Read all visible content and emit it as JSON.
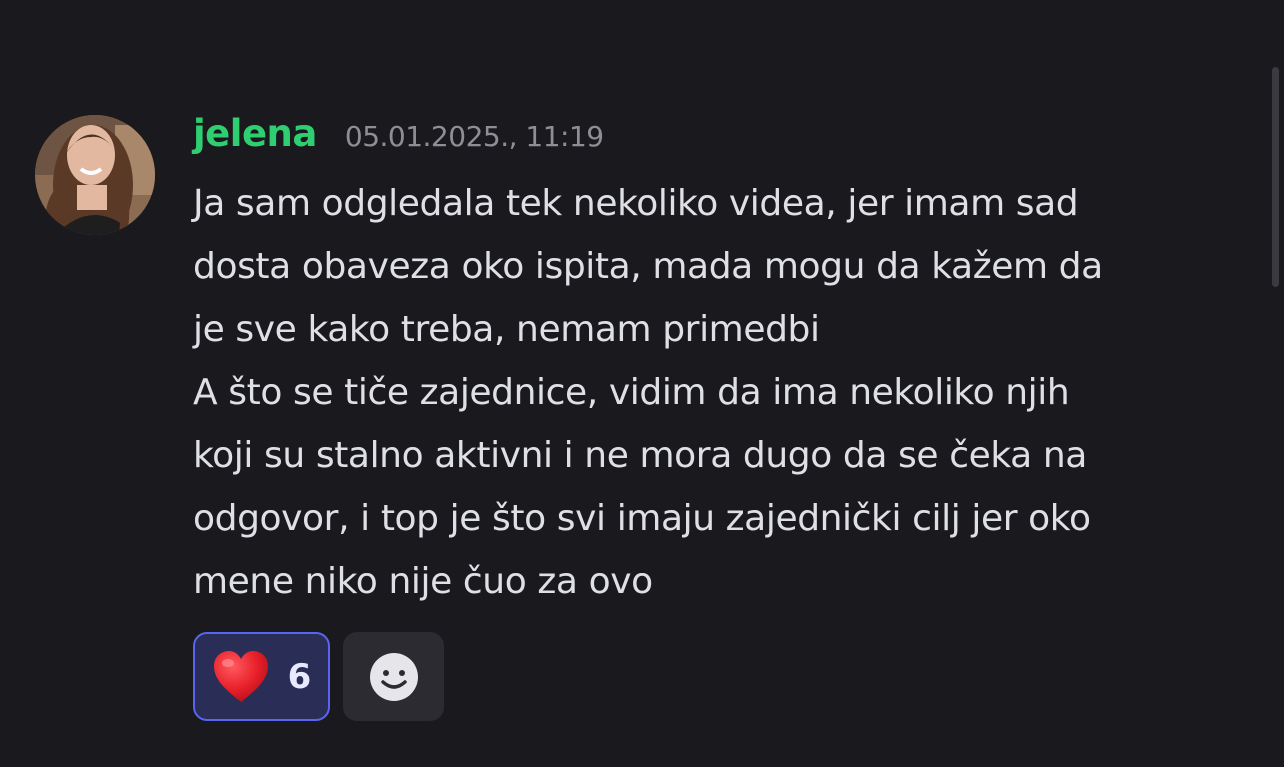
{
  "message": {
    "username": "jelena",
    "timestamp": "05.01.2025., 11:19",
    "lines": [
      "Ja sam odgledala tek nekoliko videa, jer imam sad",
      "dosta obaveza oko ispita, mada mogu da kažem da",
      "je sve kako treba, nemam primedbi",
      "A što se tiče zajednice, vidim da ima nekoliko njih",
      "koji su stalno aktivni i ne mora dugo da se čeka na",
      "odgovor, i top je što svi imaju zajednički cilj jer oko",
      "mene niko nije čuo za ovo"
    ]
  },
  "reactions": [
    {
      "emoji": "heart-icon",
      "count": "6",
      "active": true
    }
  ],
  "add_reaction": {
    "icon": "smiley-face-icon"
  },
  "colors": {
    "background": "#1a1a1e",
    "username": "#2fcf71",
    "timestamp": "#8d8e96",
    "text": "#dfe0e5",
    "reaction_active_bg": "#2a2d55",
    "reaction_active_border": "#5865f2",
    "heart": "#e8202a"
  }
}
